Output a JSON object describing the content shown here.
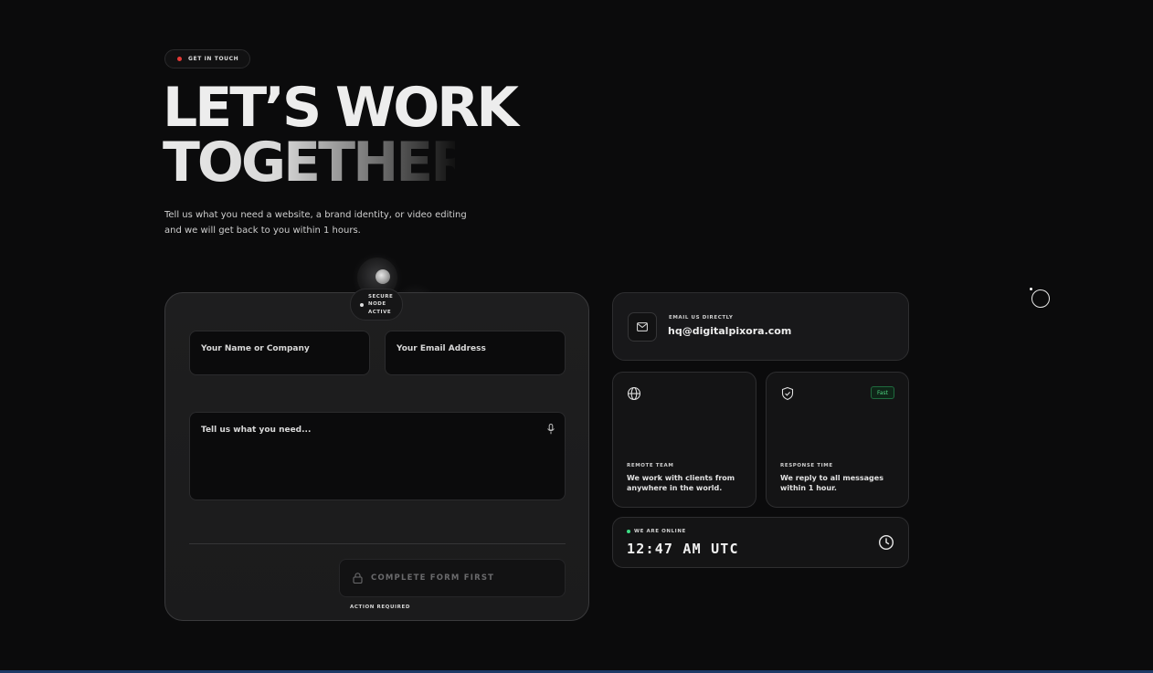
{
  "badge": {
    "label": "GET IN TOUCH",
    "dot_color": "#e53935"
  },
  "headline": {
    "line1": "LET’S WORK",
    "line2": "TOGETHER."
  },
  "subtext": "Tell us what you need a website, a brand identity, or video editing and we will get back to you within 1 hours.",
  "secure": {
    "line1": "SECURE",
    "line2": "NODE",
    "line3": "ACTIVE"
  },
  "form": {
    "name_placeholder": "Your Name or Company",
    "email_placeholder": "Your Email Address",
    "message_placeholder": "Tell us what you need...",
    "mic_icon": "microphone-icon",
    "submit_label": "COMPLETE FORM FIRST",
    "submit_icon": "lock-icon",
    "action_required": "ACTION REQUIRED"
  },
  "email_card": {
    "icon": "mail-icon",
    "label": "EMAIL US DIRECTLY",
    "value": "hq@digitalpixora.com"
  },
  "remote_card": {
    "icon": "globe-icon",
    "label": "REMOTE TEAM",
    "description": "We work with clients from anywhere in the world."
  },
  "response_card": {
    "icon": "shield-check-icon",
    "badge": "Fast",
    "badge_color": "#4ccf7e",
    "label": "RESPONSE TIME",
    "description": "We reply to all messages within 1 hour."
  },
  "status_card": {
    "online_label": "WE ARE ONLINE",
    "online_color": "#3ddc84",
    "time": "12:47 AM UTC",
    "icon": "clock-icon"
  }
}
